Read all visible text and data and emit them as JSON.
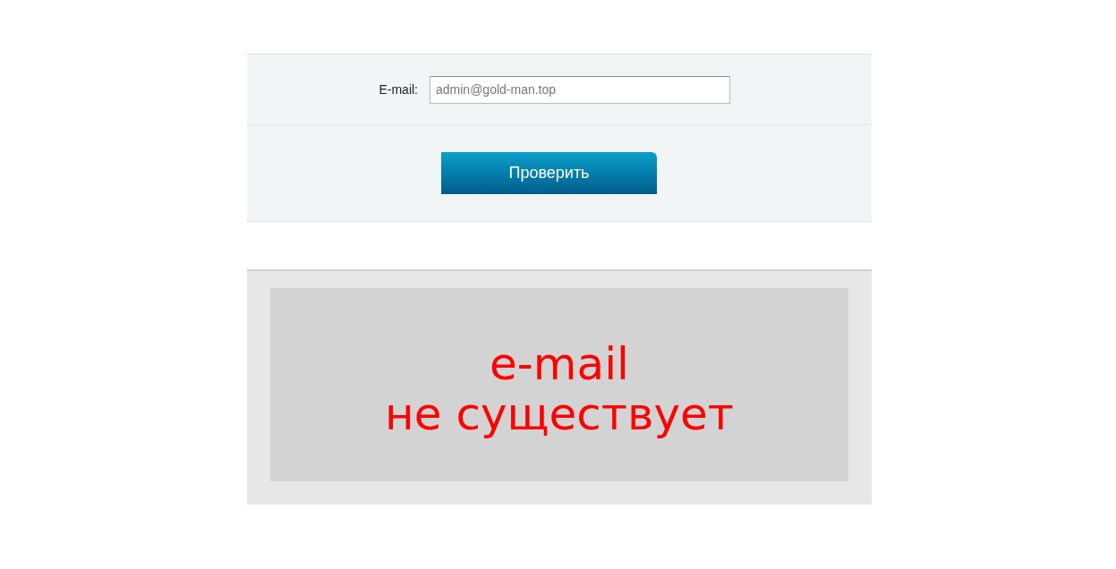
{
  "form": {
    "email_label": "E-mail:",
    "email_placeholder": "admin@gold-man.top",
    "submit_button": "Проверить"
  },
  "result": {
    "message": "e-mail\nне существует"
  }
}
